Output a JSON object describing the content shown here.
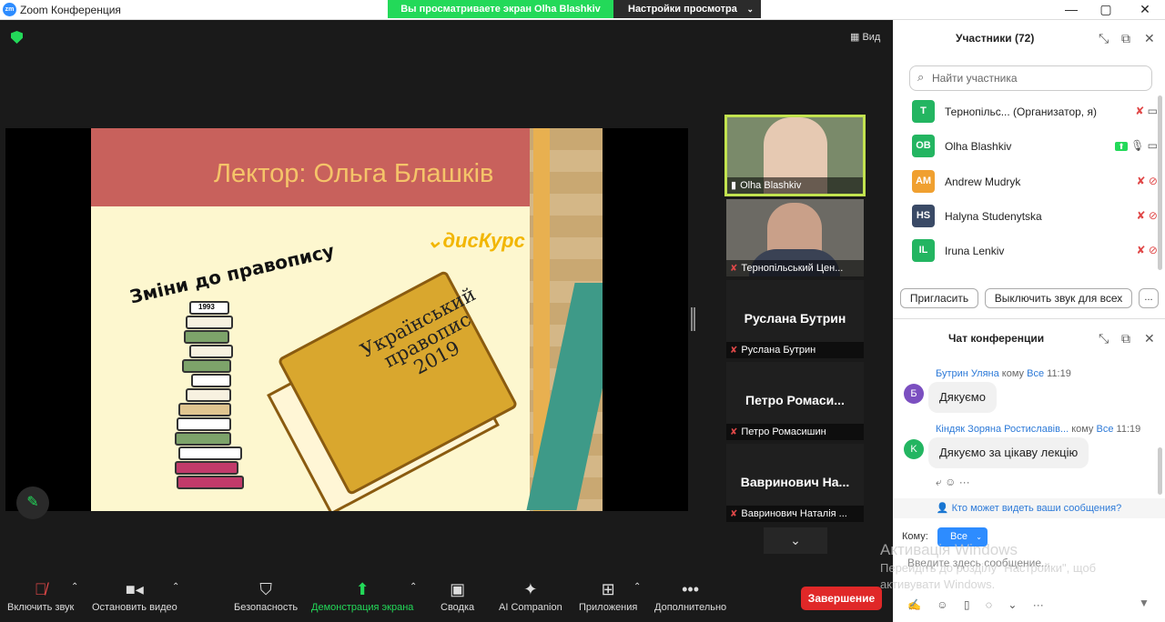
{
  "window": {
    "app_title": "Zoom Конференция",
    "minimize": "—",
    "maximize": "▢",
    "close": "✕"
  },
  "banner": {
    "viewing_text": "Вы просматриваете экран Olha Blashkiv",
    "settings_label": "Настройки просмотра"
  },
  "main": {
    "view_label": "Вид"
  },
  "slide": {
    "lector": "Лектор: Ольга Блашків",
    "brand": "дисКурс",
    "subtitle": "Зміни до правопису",
    "book_title": "Український\nправопис\n2019",
    "stack_year": "1993"
  },
  "thumbnails": [
    {
      "name": "Olha Blashkiv"
    },
    {
      "name": "Тернопільський Цен..."
    },
    {
      "display": "Руслана Бутрин",
      "name": "Руслана Бутрин"
    },
    {
      "display": "Петро Ромаси...",
      "name": "Петро Ромасишин"
    },
    {
      "display": "Вавринович На...",
      "name": "Вавринович Наталія ..."
    }
  ],
  "toolbar": {
    "unmute": "Включить звук",
    "stop_video": "Остановить видео",
    "security": "Безопасность",
    "share": "Демонстрация экрана",
    "summary": "Сводка",
    "ai": "AI Companion",
    "apps": "Приложения",
    "more": "Дополнительно",
    "end": "Завершение"
  },
  "participants": {
    "title": "Участники (72)",
    "search_placeholder": "Найти участника",
    "list": [
      {
        "initials": "T",
        "name": "Тернопільс...  (Организатор, я)",
        "color": "#23b561"
      },
      {
        "initials": "OB",
        "name": "Olha Blashkiv",
        "color": "#23b561"
      },
      {
        "initials": "AM",
        "name": "Andrew Mudryk",
        "color": "#f0a030"
      },
      {
        "initials": "HS",
        "name": "Halyna Studenytska",
        "color": "#3a4a66"
      },
      {
        "initials": "IL",
        "name": "Iruna Lenkiv",
        "color": "#23b561"
      }
    ],
    "invite": "Пригласить",
    "mute_all": "Выключить звук для всех",
    "more": "..."
  },
  "chat": {
    "title": "Чат конференции",
    "messages": [
      {
        "initial": "Б",
        "sender": "Бутрин Уляна",
        "to_word": "кому",
        "to": "Все",
        "time": "11:19",
        "text": "Дякуємо",
        "color": "#7b4fc0"
      },
      {
        "initial": "K",
        "sender": "Кіндяк Зоряна Ростиславів...",
        "to_word": "кому",
        "to": "Все",
        "time": "11:19",
        "text": "Дякуємо за цікаву лекцію",
        "color": "#23b561"
      }
    ],
    "who_sees": "Кто может видеть ваши сообщения?",
    "to_label": "Кому:",
    "to_value": "Все",
    "input_placeholder": "Введите здесь сообщение..."
  },
  "activation": {
    "title": "Активація Windows",
    "text": "Перейдіть до розділу \"Настройки\", щоб\nактивувати Windows."
  }
}
